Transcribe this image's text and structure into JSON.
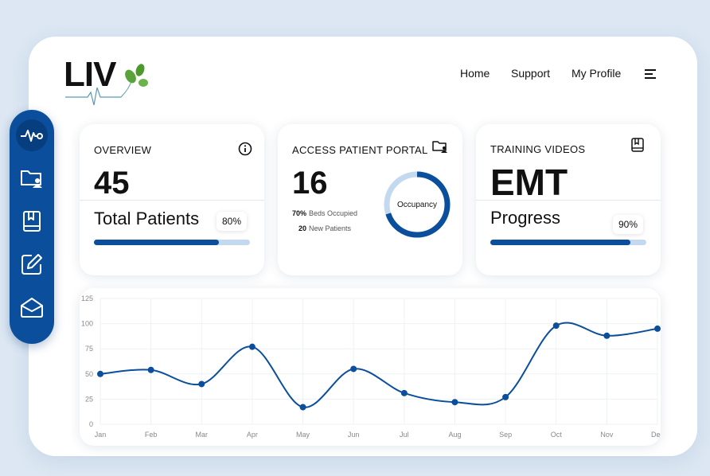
{
  "brand": {
    "logo_text": "LIV"
  },
  "nav": {
    "home": "Home",
    "support": "Support",
    "profile": "My Profile"
  },
  "cards": {
    "overview": {
      "title": "OVERVIEW",
      "value": "45",
      "label": "Total Patients",
      "percent_label": "80%",
      "progress": 0.8
    },
    "portal": {
      "title": "ACCESS PATIENT PORTAL",
      "value": "16",
      "stat1_value": "70%",
      "stat1_label": "Beds Occupied",
      "stat2_value": "20",
      "stat2_label": "New Patients",
      "donut_label": "Occupancy",
      "occupancy": 0.7
    },
    "training": {
      "title": "TRAINING VIDEOS",
      "value": "EMT",
      "label": "Progress",
      "percent_label": "90%",
      "progress": 0.9
    }
  },
  "colors": {
    "accent": "#0b4f9c",
    "track": "#c2d9f0",
    "background": "#dce7f3"
  },
  "icons": {
    "sidebar": [
      "pulse-icon",
      "folder-user-icon",
      "book-icon",
      "edit-icon",
      "mail-icon"
    ]
  },
  "chart_data": {
    "type": "line",
    "categories": [
      "Jan",
      "Feb",
      "Mar",
      "Apr",
      "May",
      "Jun",
      "Jul",
      "Aug",
      "Sep",
      "Oct",
      "Nov",
      "Dec"
    ],
    "values": [
      50,
      54,
      40,
      77,
      17,
      55,
      31,
      22,
      27,
      98,
      88,
      95
    ],
    "yticks": [
      0,
      25,
      50,
      75,
      100,
      125
    ],
    "ylim": [
      0,
      125
    ],
    "grid": true,
    "xlabel": "",
    "ylabel": "",
    "title": ""
  }
}
